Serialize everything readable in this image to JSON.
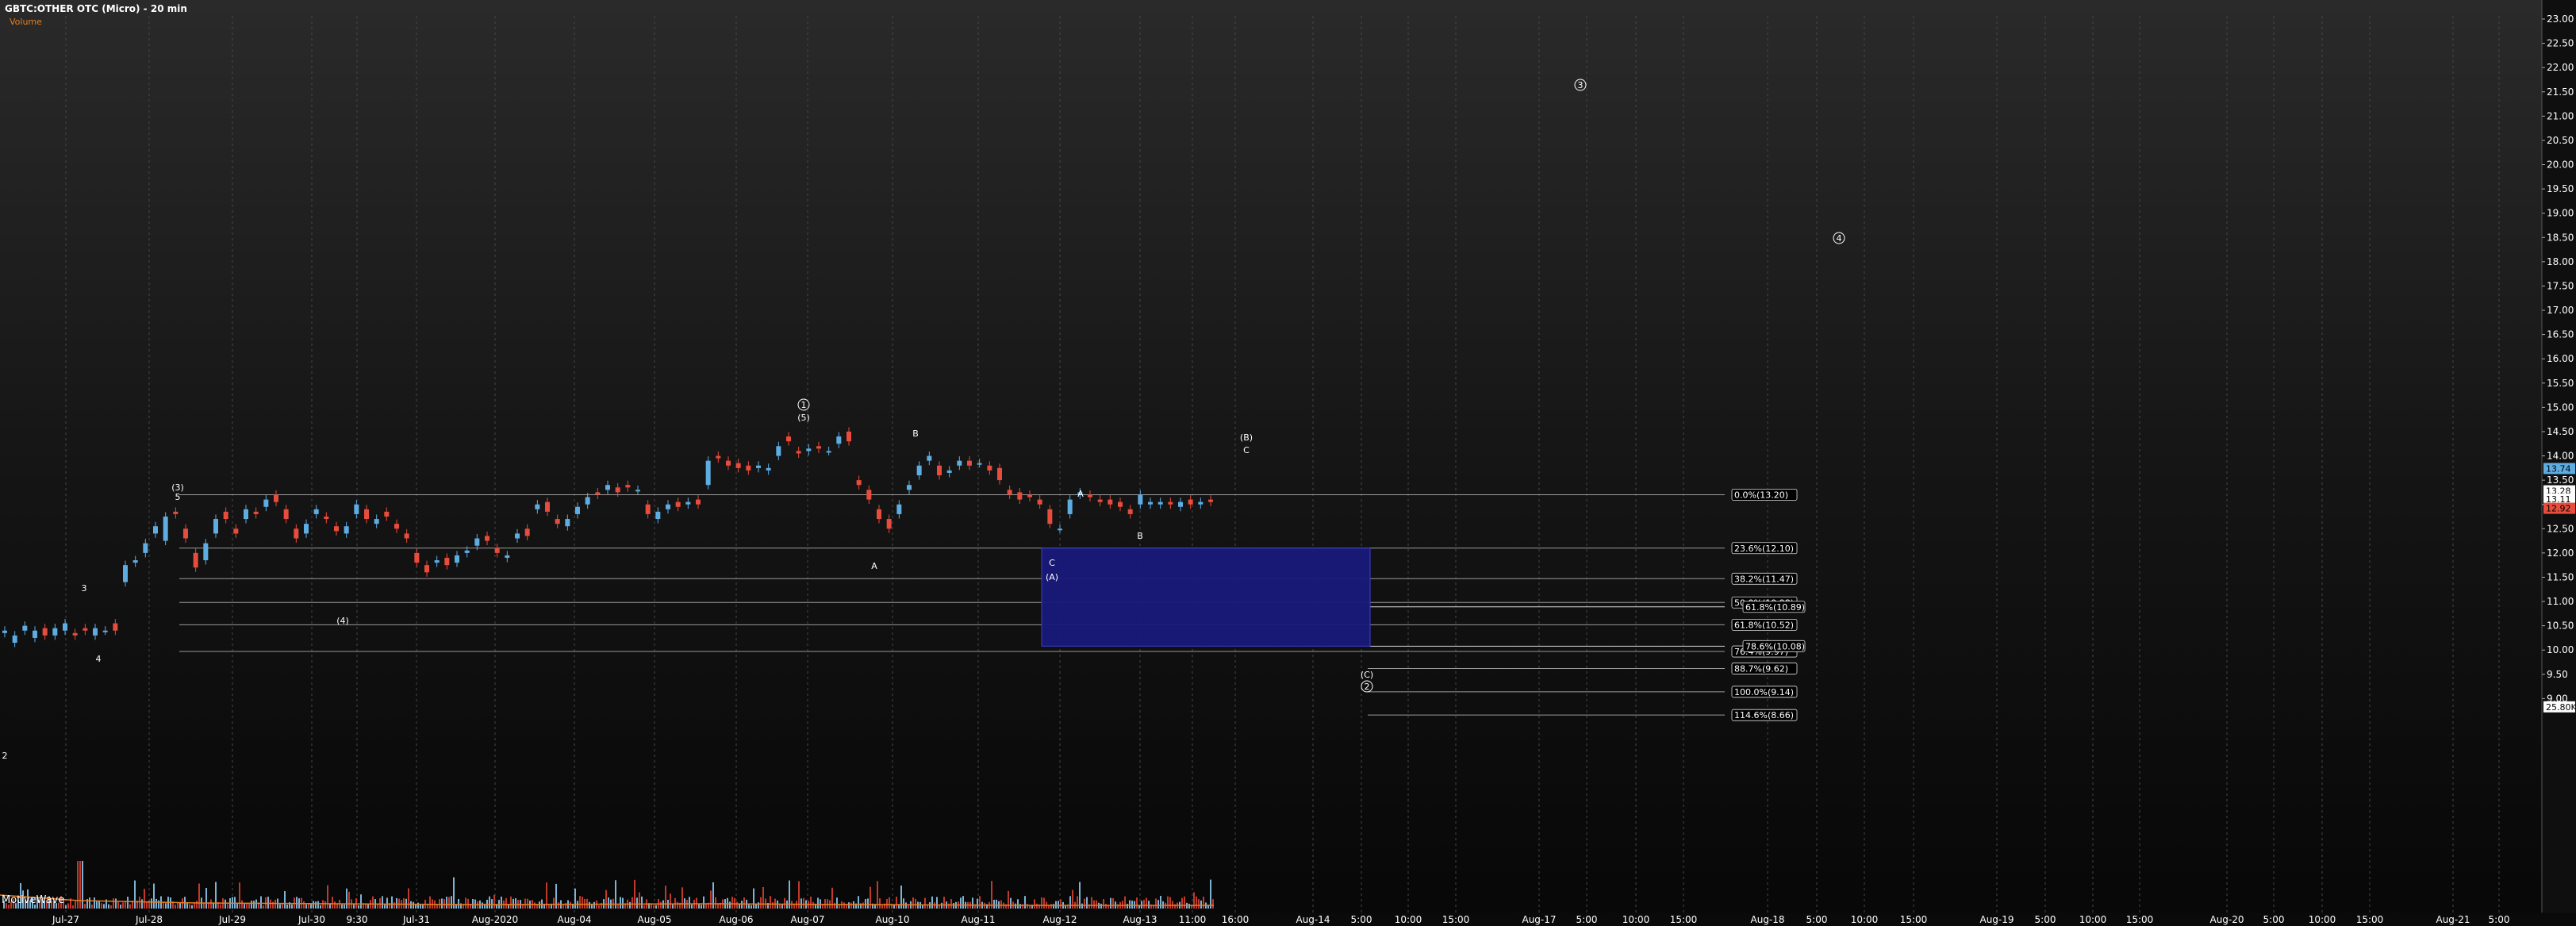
{
  "header": {
    "symbol": "GBTC:OTHER OTC (Micro) - 20 min",
    "sub": "Volume"
  },
  "watermark": "MotiveWave",
  "colors": {
    "up": "#5dade2",
    "down": "#e74c3c",
    "zone": "#191a7a",
    "text": "#ffffff",
    "subtitle": "#e67e22"
  },
  "chart_data": {
    "type": "candlestick",
    "title": "GBTC:OTHER OTC (Micro) - 20 min",
    "ylim": [
      8.8,
      23.3
    ],
    "y_ticks": [
      "23.00",
      "22.50",
      "22.00",
      "21.50",
      "21.00",
      "20.50",
      "20.00",
      "19.50",
      "19.00",
      "18.50",
      "18.00",
      "17.50",
      "17.00",
      "16.50",
      "16.00",
      "15.50",
      "15.00",
      "14.50",
      "14.00",
      "13.50",
      "13.00",
      "12.50",
      "12.00",
      "11.50",
      "11.00",
      "10.50",
      "10.00",
      "9.50",
      "9.00"
    ],
    "price_tags": [
      {
        "label": "13.74",
        "value": 13.74,
        "color": "#5dade2"
      },
      {
        "label": "13.28",
        "value": 13.28,
        "color": "#ffffff"
      },
      {
        "label": "13.11",
        "value": 13.11,
        "color": "#ffffff"
      },
      {
        "label": "12.92",
        "value": 12.92,
        "color": "#e74c3c"
      },
      {
        "label": "25.80K",
        "value": 8.83,
        "color": "#ffffff"
      }
    ],
    "x_ticks": [
      "Jul-27",
      "Jul-28",
      "Jul-29",
      "Jul-30",
      "9:30",
      "Jul-31",
      "Aug-2020",
      "Aug-04",
      "Aug-05",
      "Aug-06",
      "Aug-07",
      "Aug-10",
      "Aug-11",
      "Aug-12",
      "Aug-13",
      "11:00",
      "16:00",
      "Aug-14",
      "5:00",
      "10:00",
      "15:00",
      "Aug-17",
      "5:00",
      "10:00",
      "15:00",
      "Aug-18",
      "5:00",
      "10:00",
      "15:00",
      "Aug-19",
      "5:00",
      "10:00",
      "15:00",
      "Aug-20",
      "5:00",
      "10:00",
      "15:00",
      "Aug-21",
      "5:00"
    ],
    "price_path": [
      [
        10.35,
        10.4
      ],
      [
        10.15,
        10.3
      ],
      [
        10.4,
        10.5
      ],
      [
        10.25,
        10.4
      ],
      [
        10.45,
        10.3
      ],
      [
        10.3,
        10.45
      ],
      [
        10.4,
        10.55
      ],
      [
        10.35,
        10.3
      ],
      [
        10.45,
        10.4
      ],
      [
        10.3,
        10.45
      ],
      [
        10.4,
        10.4
      ],
      [
        10.55,
        10.4
      ],
      [
        11.4,
        11.75
      ],
      [
        11.8,
        11.85
      ],
      [
        12.0,
        12.2
      ],
      [
        12.4,
        12.55
      ],
      [
        12.25,
        12.75
      ],
      [
        12.85,
        12.8
      ],
      [
        12.5,
        12.3
      ],
      [
        12.0,
        11.7
      ],
      [
        11.85,
        12.2
      ],
      [
        12.4,
        12.7
      ],
      [
        12.85,
        12.7
      ],
      [
        12.5,
        12.4
      ],
      [
        12.7,
        12.9
      ],
      [
        12.85,
        12.8
      ],
      [
        12.95,
        13.1
      ],
      [
        13.2,
        13.05
      ],
      [
        12.9,
        12.7
      ],
      [
        12.5,
        12.3
      ],
      [
        12.4,
        12.6
      ],
      [
        12.8,
        12.9
      ],
      [
        12.75,
        12.7
      ],
      [
        12.55,
        12.45
      ],
      [
        12.4,
        12.55
      ],
      [
        12.8,
        13.0
      ],
      [
        12.9,
        12.7
      ],
      [
        12.6,
        12.7
      ],
      [
        12.85,
        12.75
      ],
      [
        12.6,
        12.5
      ],
      [
        12.4,
        12.3
      ],
      [
        12.0,
        11.8
      ],
      [
        11.75,
        11.6
      ],
      [
        11.8,
        11.85
      ],
      [
        11.9,
        11.75
      ],
      [
        11.8,
        11.95
      ],
      [
        12.0,
        12.05
      ],
      [
        12.15,
        12.3
      ],
      [
        12.35,
        12.25
      ],
      [
        12.1,
        12.0
      ],
      [
        11.9,
        11.95
      ],
      [
        12.3,
        12.4
      ],
      [
        12.5,
        12.35
      ],
      [
        12.9,
        13.0
      ],
      [
        13.05,
        12.85
      ],
      [
        12.7,
        12.6
      ],
      [
        12.55,
        12.7
      ],
      [
        12.8,
        12.95
      ],
      [
        13.0,
        13.15
      ],
      [
        13.25,
        13.2
      ],
      [
        13.3,
        13.4
      ],
      [
        13.35,
        13.25
      ],
      [
        13.4,
        13.35
      ],
      [
        13.3,
        13.3
      ],
      [
        13.0,
        12.8
      ],
      [
        12.7,
        12.85
      ],
      [
        12.9,
        13.0
      ],
      [
        13.05,
        12.95
      ],
      [
        13.0,
        13.05
      ],
      [
        13.1,
        13.0
      ],
      [
        13.4,
        13.9
      ],
      [
        14.0,
        13.95
      ],
      [
        13.9,
        13.8
      ],
      [
        13.85,
        13.75
      ],
      [
        13.8,
        13.7
      ],
      [
        13.75,
        13.8
      ],
      [
        13.7,
        13.75
      ],
      [
        14.0,
        14.2
      ],
      [
        14.4,
        14.3
      ],
      [
        14.1,
        14.05
      ],
      [
        14.1,
        14.15
      ],
      [
        14.2,
        14.15
      ],
      [
        14.1,
        14.1
      ],
      [
        14.25,
        14.4
      ],
      [
        14.5,
        14.3
      ],
      [
        13.5,
        13.4
      ],
      [
        13.3,
        13.1
      ],
      [
        12.9,
        12.7
      ],
      [
        12.7,
        12.5
      ],
      [
        12.8,
        13.0
      ],
      [
        13.3,
        13.4
      ],
      [
        13.6,
        13.8
      ],
      [
        13.9,
        14.0
      ],
      [
        13.8,
        13.6
      ],
      [
        13.65,
        13.7
      ],
      [
        13.8,
        13.9
      ],
      [
        13.9,
        13.8
      ],
      [
        13.85,
        13.85
      ],
      [
        13.8,
        13.7
      ],
      [
        13.75,
        13.5
      ],
      [
        13.3,
        13.2
      ],
      [
        13.25,
        13.1
      ],
      [
        13.2,
        13.15
      ],
      [
        13.1,
        13.0
      ],
      [
        12.9,
        12.6
      ],
      [
        12.5,
        12.5
      ],
      [
        12.8,
        13.1
      ],
      [
        13.2,
        13.25
      ],
      [
        13.2,
        13.15
      ],
      [
        13.1,
        13.05
      ],
      [
        13.1,
        13.0
      ],
      [
        13.05,
        12.95
      ],
      [
        12.9,
        12.8
      ],
      [
        13.0,
        13.2
      ],
      [
        13.0,
        13.05
      ],
      [
        13.0,
        13.05
      ],
      [
        13.05,
        13.0
      ],
      [
        12.95,
        13.05
      ],
      [
        13.1,
        13.0
      ],
      [
        13.0,
        13.05
      ],
      [
        13.1,
        13.05
      ]
    ],
    "fibonacci": [
      {
        "label": "0.0%(13.20)",
        "value": 13.2
      },
      {
        "label": "23.6%(12.10)",
        "value": 12.1
      },
      {
        "label": "38.2%(11.47)",
        "value": 11.47
      },
      {
        "label": "50.0%(10.98)",
        "value": 10.98
      },
      {
        "label": "61.8%(10.52)",
        "value": 10.52
      },
      {
        "label": "76.4%(9.97)",
        "value": 9.97
      },
      {
        "label": "88.7%(9.62)",
        "value": 9.62
      },
      {
        "label": "100.0%(9.14)",
        "value": 9.14
      },
      {
        "label": "114.6%(8.66)",
        "value": 8.66
      }
    ],
    "fib_extensions": [
      {
        "label": "61.8%(10.89)",
        "value": 10.89
      },
      {
        "label": "78.6%(10.08)",
        "value": 10.08
      }
    ],
    "target_zone": {
      "from": 10.08,
      "to": 12.1
    },
    "wave_labels": [
      "(3)",
      "5",
      "3",
      "4",
      "2",
      "(4)",
      "1",
      "(5)",
      "B",
      "A",
      "A",
      "B",
      "C",
      "(A)",
      "(B)",
      "C",
      "(C)",
      "2",
      "3",
      "4"
    ]
  }
}
